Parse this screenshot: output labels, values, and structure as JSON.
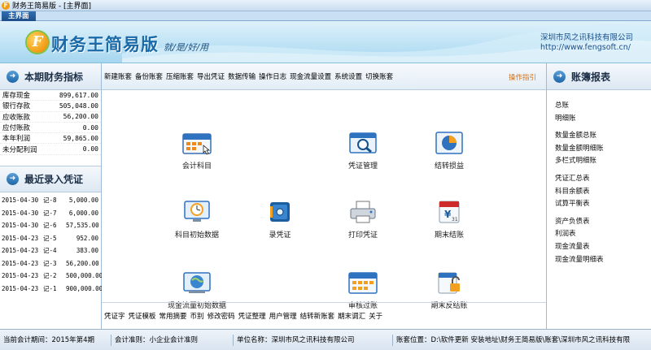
{
  "window": {
    "title": "财务王简易版 - [主界面]"
  },
  "tab": {
    "label": "主界面"
  },
  "banner": {
    "logo_letter": "F",
    "brand": "财务王简易版",
    "slogan": "就/是/好/用",
    "company": "深圳市风之讯科技有限公司",
    "url": "http://www.fengsoft.cn/"
  },
  "left": {
    "kpi_title": "本期财务指标",
    "kpis": [
      {
        "label": "库存现金",
        "value": "899,617.00"
      },
      {
        "label": "银行存款",
        "value": "505,048.00"
      },
      {
        "label": "应收账款",
        "value": "56,200.00"
      },
      {
        "label": "应付账款",
        "value": "0.00"
      },
      {
        "label": "本年利润",
        "value": "59,865.00"
      },
      {
        "label": "未分配利润",
        "value": "0.00"
      }
    ],
    "voucher_title": "最近录入凭证",
    "vouchers": [
      {
        "date": "2015-04-30",
        "no": "记-8",
        "amount": "5,000.00"
      },
      {
        "date": "2015-04-30",
        "no": "记-7",
        "amount": "6,000.00"
      },
      {
        "date": "2015-04-30",
        "no": "记-6",
        "amount": "57,535.00"
      },
      {
        "date": "2015-04-23",
        "no": "记-5",
        "amount": "952.00"
      },
      {
        "date": "2015-04-23",
        "no": "记-4",
        "amount": "383.00"
      },
      {
        "date": "2015-04-23",
        "no": "记-3",
        "amount": "56,200.00"
      },
      {
        "date": "2015-04-23",
        "no": "记-2",
        "amount": "500,000.00"
      },
      {
        "date": "2015-04-23",
        "no": "记-1",
        "amount": "900,000.00"
      }
    ]
  },
  "center": {
    "top_menu": [
      "新建账套",
      "备份账套",
      "压缩账套",
      "导出凭证",
      "数据传输",
      "操作日志",
      "现金流量设置",
      "系统设置",
      "切换账套"
    ],
    "guide": "操作指引",
    "icons": {
      "accounts": "会计科目",
      "voucher_mgmt": "凭证管理",
      "carry_pl": "结转损益",
      "initial_data": "科目初始数据",
      "enter_voucher": "录凭证",
      "print_voucher": "打印凭证",
      "period_close": "期末结账",
      "cashflow_init": "现金流量初始数据",
      "audit_post": "审核过账",
      "reverse_close": "期末反结账"
    },
    "bottom_menu": [
      "凭证字",
      "凭证模板",
      "常用摘要",
      "币别",
      "修改密码",
      "凭证整理",
      "用户管理",
      "结转新账套",
      "期末调汇",
      "关于"
    ]
  },
  "right": {
    "title": "账簿报表",
    "groups": [
      [
        "总账",
        "明细账"
      ],
      [
        "数量金额总账",
        "数量金额明细账",
        "多栏式明细账"
      ],
      [
        "凭证汇总表",
        "科目余额表",
        "试算平衡表"
      ],
      [
        "资产负债表",
        "利润表",
        "现金流量表",
        "现金流量明细表"
      ]
    ]
  },
  "status": {
    "period": "当前会计期间：2015年第4期",
    "standard": "会计准则：小企业会计准则",
    "unit": "单位名称：深圳市风之讯科技有限公司",
    "path": "账套位置：D:\\软件更新 安装地址\\财务王简易版\\账套\\深圳市风之讯科技有限"
  },
  "colors": {
    "brand_blue": "#1b6aa8",
    "guide_orange": "#d1731c",
    "banner_blue": "#bfe3f5"
  }
}
